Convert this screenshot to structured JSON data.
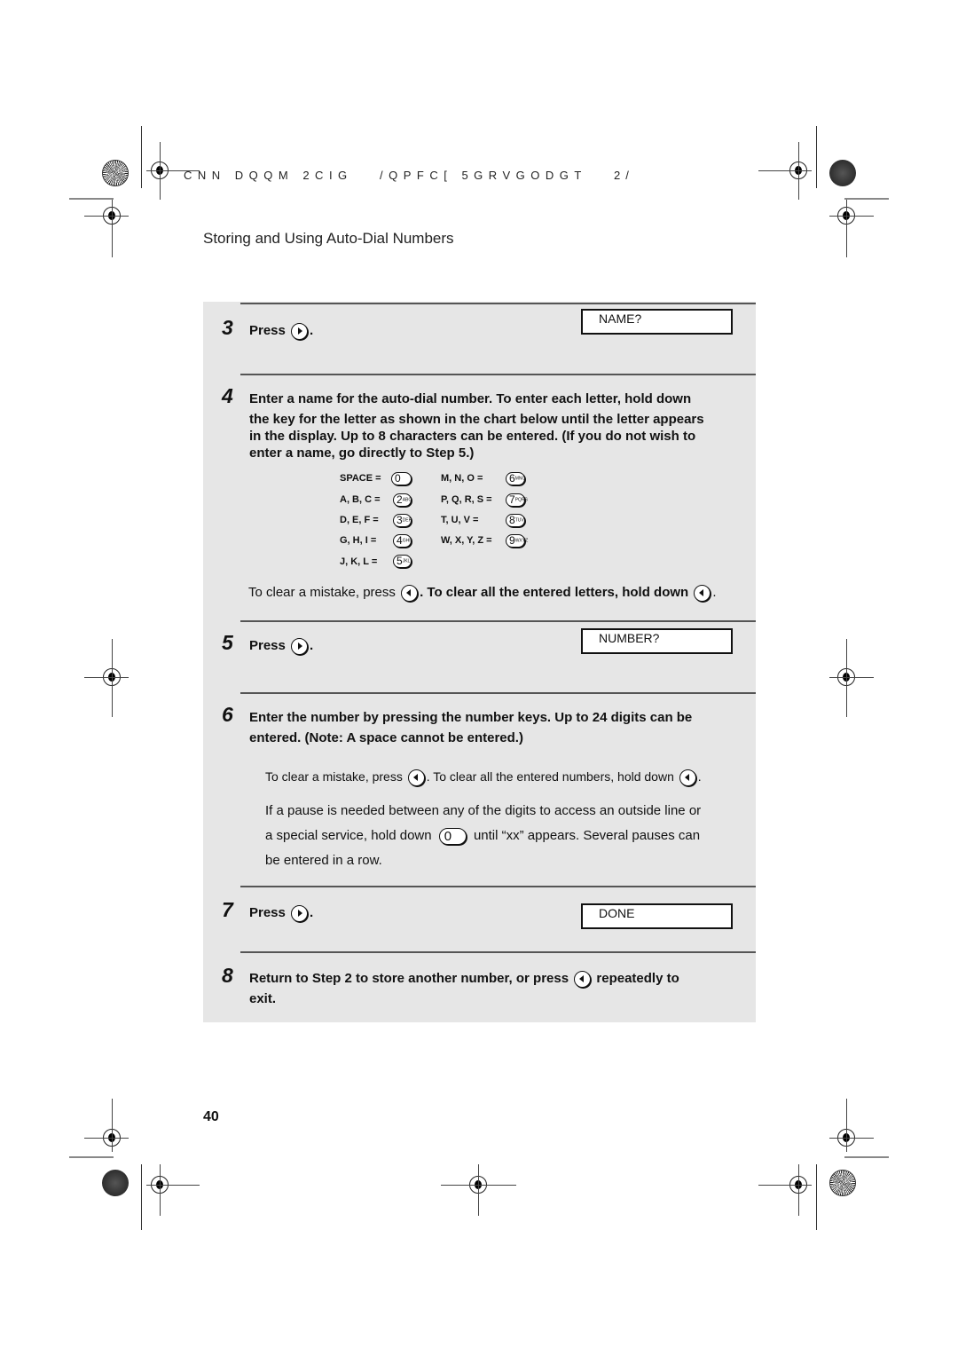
{
  "header": {
    "code_left": "CNN DQQM 2CIG   /QPFC[ 5GRVGODGT",
    "code_right": "2/",
    "section_title": "Storing and Using Auto-Dial Numbers"
  },
  "steps": {
    "s3": {
      "num": "3",
      "text": "Press",
      "suffix": ".",
      "display": "NAME?"
    },
    "s4": {
      "num": "4",
      "lines": [
        "Enter a name for the auto-dial number. To enter each letter, hold down",
        "the key for the letter as shown in the chart below until the letter appears",
        "in the display. Up to 8 characters can be entered. (If you do not wish to",
        "enter a name, go directly to Step 5.)"
      ],
      "key_chart": [
        {
          "label": "SPACE =",
          "key": "0",
          "sub": ""
        },
        {
          "label": "A, B, C =",
          "key": "2",
          "sub": "ABC"
        },
        {
          "label": "D, E, F =",
          "key": "3",
          "sub": "DEF"
        },
        {
          "label": "G, H, I =",
          "key": "4",
          "sub": "GHI"
        },
        {
          "label": "J, K, L =",
          "key": "5",
          "sub": "JKL"
        },
        {
          "label": "M, N, O =",
          "key": "6",
          "sub": "MNO"
        },
        {
          "label": "P, Q, R, S =",
          "key": "7",
          "sub": "PQRS"
        },
        {
          "label": "T, U, V =",
          "key": "8",
          "sub": "TUV"
        },
        {
          "label": "W, X, Y, Z =",
          "key": "9",
          "sub": "WXYZ"
        }
      ],
      "clear_part1": "To clear a mistake, press",
      "clear_part2": ". To clear all the entered letters, hold down",
      "clear_part3": "."
    },
    "s5": {
      "num": "5",
      "text": "Press",
      "suffix": ".",
      "display": "NUMBER?"
    },
    "s6": {
      "num": "6",
      "lines": [
        "Enter the number by pressing the number keys.  Up to 24 digits can be",
        "entered. (Note: A space cannot be entered.)"
      ],
      "clear_part1": "To clear a mistake, press",
      "clear_part2": ". To clear all the entered numbers, hold down",
      "clear_part3": ".",
      "pause_line1": "If a pause is needed between any of the digits to access an outside line or",
      "pause_line2a": "a special service, hold down",
      "pause_key": "0",
      "pause_line2b": "until “xx” appears. Several pauses can",
      "pause_line3": "be entered in a row."
    },
    "s7": {
      "num": "7",
      "text": "Press",
      "suffix": ".",
      "display": "DONE"
    },
    "s8": {
      "num": "8",
      "line1a": "Return to Step 2 to store another number, or press",
      "line1b": "repeatedly to",
      "line2": "exit."
    }
  },
  "icons": {
    "right_arrow_key": "right-arrow-key-icon",
    "left_arrow_key": "left-arrow-key-icon",
    "registration_mark": "registration-mark-icon",
    "color_rosette": "rosette-icon"
  },
  "footer": {
    "page_number": "40"
  },
  "colors": {
    "panel_bg": "#e6e6e6",
    "rule": "#555555",
    "text": "#111111"
  }
}
